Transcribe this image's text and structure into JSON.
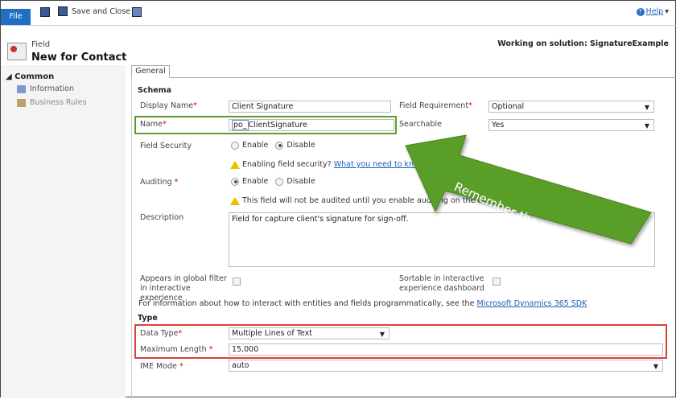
{
  "toolbar": {
    "file": "File",
    "save_close": "Save and Close",
    "help": "Help"
  },
  "header": {
    "entity": "Field",
    "title": "New for Contact",
    "solution": "Working on solution: SignatureExample"
  },
  "sidebar": {
    "section": "Common",
    "items": [
      {
        "label": "Information"
      },
      {
        "label": "Business Rules"
      }
    ]
  },
  "tabs": [
    {
      "label": "General"
    }
  ],
  "schema": {
    "heading": "Schema",
    "display_name_label": "Display Name",
    "display_name": "Client Signature",
    "field_requirement_label": "Field Requirement",
    "field_requirement": "Optional",
    "name_label": "Name",
    "name_prefix": "po_",
    "name_value": "ClientSignature",
    "searchable_label": "Searchable",
    "searchable": "Yes",
    "field_security_label": "Field Security",
    "enable": "Enable",
    "disable": "Disable",
    "field_security_selected": "Disable",
    "security_warning": "Enabling field security?",
    "security_link": "What you need to know",
    "auditing_label": "Auditing",
    "auditing_selected": "Enable",
    "audit_warning": "This field will not be audited until you enable auditing on the entity.",
    "description_label": "Description",
    "description": "Field for capture client's signature for sign-off.",
    "global_filter_label": "Appears in global filter in interactive experience",
    "sortable_label": "Sortable in interactive experience dashboard",
    "info_text": "For information about how to interact with entities and fields programmatically, see the",
    "info_link": "Microsoft Dynamics 365 SDK"
  },
  "type": {
    "heading": "Type",
    "data_type_label": "Data Type",
    "data_type": "Multiple Lines of Text",
    "max_length_label": "Maximum Length",
    "max_length": "15,000",
    "ime_label": "IME Mode",
    "ime": "auto"
  },
  "callout": {
    "text": "Remember the schema name!",
    "color": "#5a9e2a"
  },
  "colors": {
    "green_highlight": "#5a9e2a",
    "red_highlight": "#d9413a",
    "file_button": "#1f6fc5"
  }
}
